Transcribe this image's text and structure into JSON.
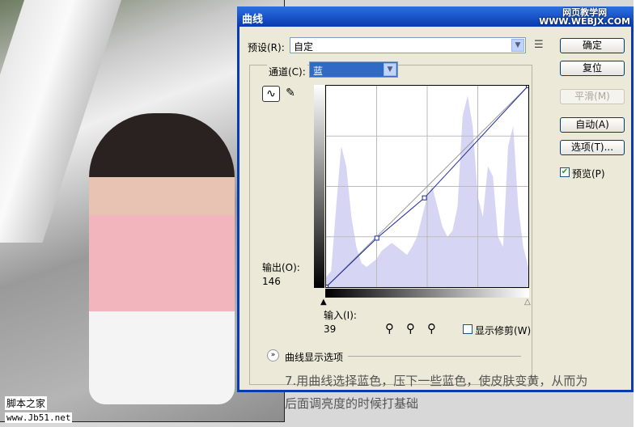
{
  "dialog": {
    "title": "曲线",
    "watermark_top": "网页教学网",
    "watermark_bottom": "WWW.WEBJX.COM"
  },
  "preset": {
    "label": "预设(R):",
    "value": "自定"
  },
  "channel": {
    "label": "通道(C):",
    "value": "蓝"
  },
  "buttons": {
    "ok": "确定",
    "reset": "复位",
    "smooth": "平滑(M)",
    "auto": "自动(A)",
    "options": "选项(T)...",
    "preview": "预览(P)"
  },
  "output": {
    "label": "输出(O):",
    "value": "146"
  },
  "input": {
    "label": "输入(I):",
    "value": "39"
  },
  "show_clipping": "显示修剪(W)",
  "curve_display_options": "曲线显示选项",
  "preview_checked": true,
  "curve_points": [
    [
      0,
      0
    ],
    [
      64,
      62
    ],
    [
      124,
      113
    ],
    [
      255,
      255
    ]
  ],
  "caption": {
    "line1": "7.用曲线选择蓝色，压下一些蓝色，使皮肤变黄，从而为",
    "line2": "后面调亮度的时候打基础"
  },
  "site_logo": {
    "name": "脚本之家",
    "url": "www.Jb51.net"
  },
  "colors": {
    "title": "#0a3bb0",
    "histogram": "#d6d6f4",
    "curve": "#1a2a9a"
  }
}
